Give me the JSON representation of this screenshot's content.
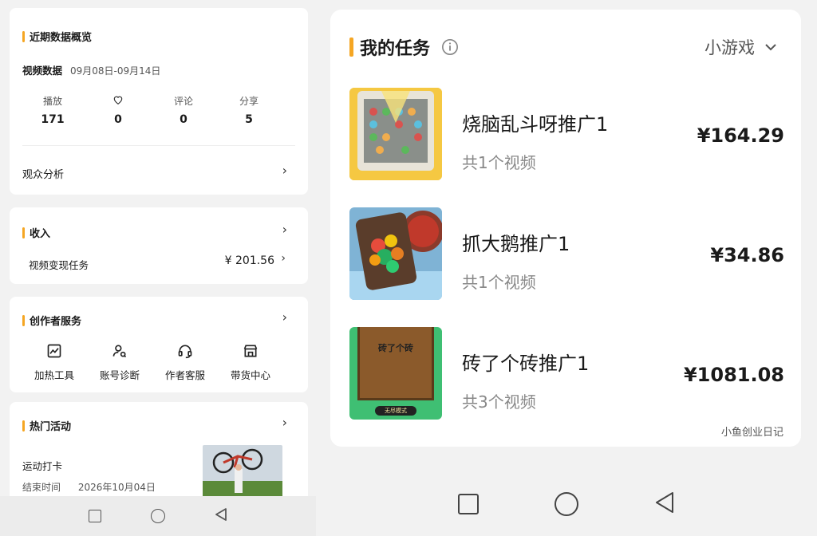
{
  "left": {
    "recent": {
      "title": "近期数据概览",
      "video_label": "视频数据",
      "date_range": "09月08日-09月14日",
      "stats": [
        {
          "label": "播放",
          "value": "171",
          "icon": "heart-icon-none"
        },
        {
          "label": "",
          "value": "0",
          "icon": "heart-icon"
        },
        {
          "label": "评论",
          "value": "0",
          "icon": ""
        },
        {
          "label": "分享",
          "value": "5",
          "icon": ""
        }
      ],
      "audience": "观众分析"
    },
    "income": {
      "title": "收入",
      "task_label": "视频变现任务",
      "amount": "¥ 201.56"
    },
    "creator": {
      "title": "创作者服务",
      "items": [
        {
          "label": "加热工具",
          "icon": "chart-icon"
        },
        {
          "label": "账号诊断",
          "icon": "user-diagnose-icon"
        },
        {
          "label": "作者客服",
          "icon": "headset-icon"
        },
        {
          "label": "带货中心",
          "icon": "shop-icon"
        }
      ]
    },
    "hot": {
      "title": "热门活动",
      "event_name": "运动打卡",
      "end_label": "结束时间",
      "end_date": "2026年10月04日"
    }
  },
  "right": {
    "header": {
      "title": "我的任务",
      "filter": "小游戏"
    },
    "tasks": [
      {
        "name": "烧脑乱斗呀推广1",
        "count": "共1个视频",
        "price": "¥164.29"
      },
      {
        "name": "抓大鹅推广1",
        "count": "共1个视频",
        "price": "¥34.86"
      },
      {
        "name": "砖了个砖推广1",
        "count": "共3个视频",
        "price": "¥1081.08"
      }
    ],
    "game3_text": "砖了个砖",
    "game3_button": "无尽模式",
    "watermark": "小鱼创业日记"
  },
  "colors": {
    "accent": "#f5a623",
    "bg": "#f2f2f2",
    "card": "#ffffff"
  }
}
